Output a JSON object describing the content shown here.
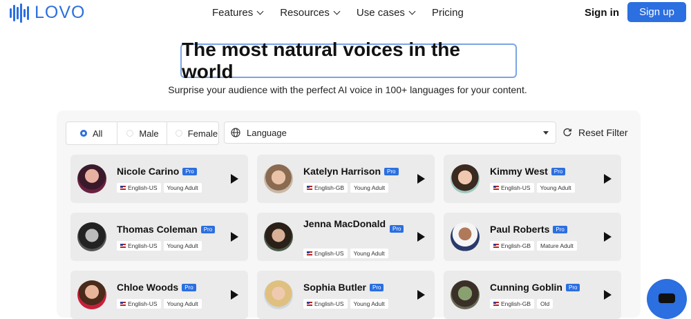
{
  "brand": {
    "name": "LOVO"
  },
  "nav": {
    "menu": [
      {
        "label": "Features",
        "dropdown": true
      },
      {
        "label": "Resources",
        "dropdown": true
      },
      {
        "label": "Use cases",
        "dropdown": true
      },
      {
        "label": "Pricing",
        "dropdown": false
      }
    ],
    "signin_label": "Sign in",
    "signup_label": "Sign up"
  },
  "hero": {
    "title": "The most natural voices in the world",
    "subtitle": "Surprise your audience with the perfect AI voice in 100+ languages for your content."
  },
  "filters": {
    "gender": [
      {
        "label": "All",
        "selected": true
      },
      {
        "label": "Male",
        "selected": false
      },
      {
        "label": "Female",
        "selected": false
      }
    ],
    "language_placeholder": "Language",
    "reset_label": "Reset Filter"
  },
  "voices": [
    {
      "name": "Nicole Carino",
      "badge": "Pro",
      "language": "English-US",
      "age": "Young Adult"
    },
    {
      "name": "Katelyn Harrison",
      "badge": "Pro",
      "language": "English-GB",
      "age": "Young Adult"
    },
    {
      "name": "Kimmy West",
      "badge": "Pro",
      "language": "English-US",
      "age": "Young Adult"
    },
    {
      "name": "Thomas Coleman",
      "badge": "Pro",
      "language": "English-US",
      "age": "Young Adult"
    },
    {
      "name": "Jenna MacDonald",
      "badge": "Pro",
      "language": "English-US",
      "age": "Young Adult"
    },
    {
      "name": "Paul Roberts",
      "badge": "Pro",
      "language": "English-GB",
      "age": "Mature Adult"
    },
    {
      "name": "Chloe Woods",
      "badge": "Pro",
      "language": "English-US",
      "age": "Young Adult"
    },
    {
      "name": "Sophia Butler",
      "badge": "Pro",
      "language": "English-US",
      "age": "Young Adult"
    },
    {
      "name": "Cunning Goblin",
      "badge": "Pro",
      "language": "English-GB",
      "age": "Old"
    }
  ],
  "colors": {
    "accent": "#2b6fe0",
    "card": "#ebebeb",
    "panel": "#f7f7f7"
  },
  "icons": {
    "play": "play-icon",
    "globe": "globe-icon",
    "reset": "refresh-icon",
    "chat": "chat-icon"
  }
}
